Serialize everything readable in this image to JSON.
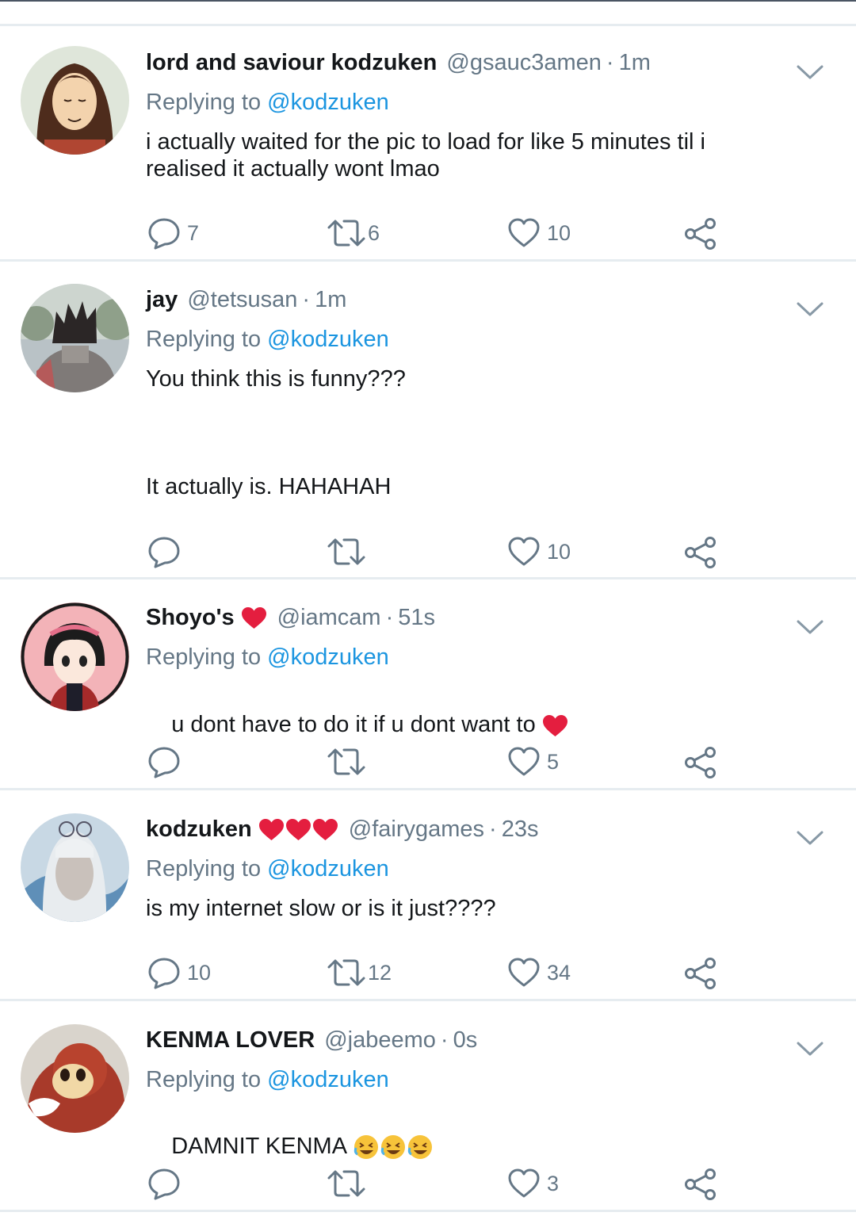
{
  "replying_label": "Replying to",
  "colors": {
    "muted": "#657786",
    "link": "#1b95e0",
    "divider": "#e6ecf0",
    "heart": "#e0245e"
  },
  "tweets": [
    {
      "name": "lord and saviour kodzuken",
      "hearts": 0,
      "handle": "@gsauc3amen",
      "dot": "·",
      "time": "1m",
      "mention": "@kodzuken",
      "text": "i actually waited for the pic to load for like 5 minutes til i\nrealised it actually wont lmao",
      "text_emoji": 0,
      "replies": "7",
      "retweets": "6",
      "likes": "10"
    },
    {
      "name": "jay",
      "hearts": 0,
      "handle": "@tetsusan",
      "dot": "·",
      "time": "1m",
      "mention": "@kodzuken",
      "text": "You think this is funny???\n\n\n\nIt actually is. HAHAHAH",
      "text_emoji": 0,
      "replies": "",
      "retweets": "",
      "likes": "10"
    },
    {
      "name": "Shoyo's",
      "hearts": 1,
      "handle": "@iamcam",
      "dot": "·",
      "time": "51s",
      "mention": "@kodzuken",
      "text": "u dont have to do it if u dont want to ",
      "text_emoji": 1,
      "text_emoji_icon": "red-heart-emoji",
      "replies": "",
      "retweets": "",
      "likes": "5"
    },
    {
      "name": "kodzuken",
      "hearts": 3,
      "handle": "@fairygames",
      "dot": "·",
      "time": "23s",
      "mention": "@kodzuken",
      "text": "is my internet slow or is it just????",
      "text_emoji": 0,
      "replies": "10",
      "retweets": "12",
      "likes": "34"
    },
    {
      "name": "KENMA LOVER",
      "hearts": 0,
      "handle": "@jabeemo",
      "dot": "·",
      "time": "0s",
      "mention": "@kodzuken",
      "text": "DAMNIT KENMA ",
      "text_emoji": 3,
      "text_emoji_icon": "rolling-laughing-emoji",
      "replies": "",
      "retweets": "",
      "likes": "3"
    }
  ]
}
